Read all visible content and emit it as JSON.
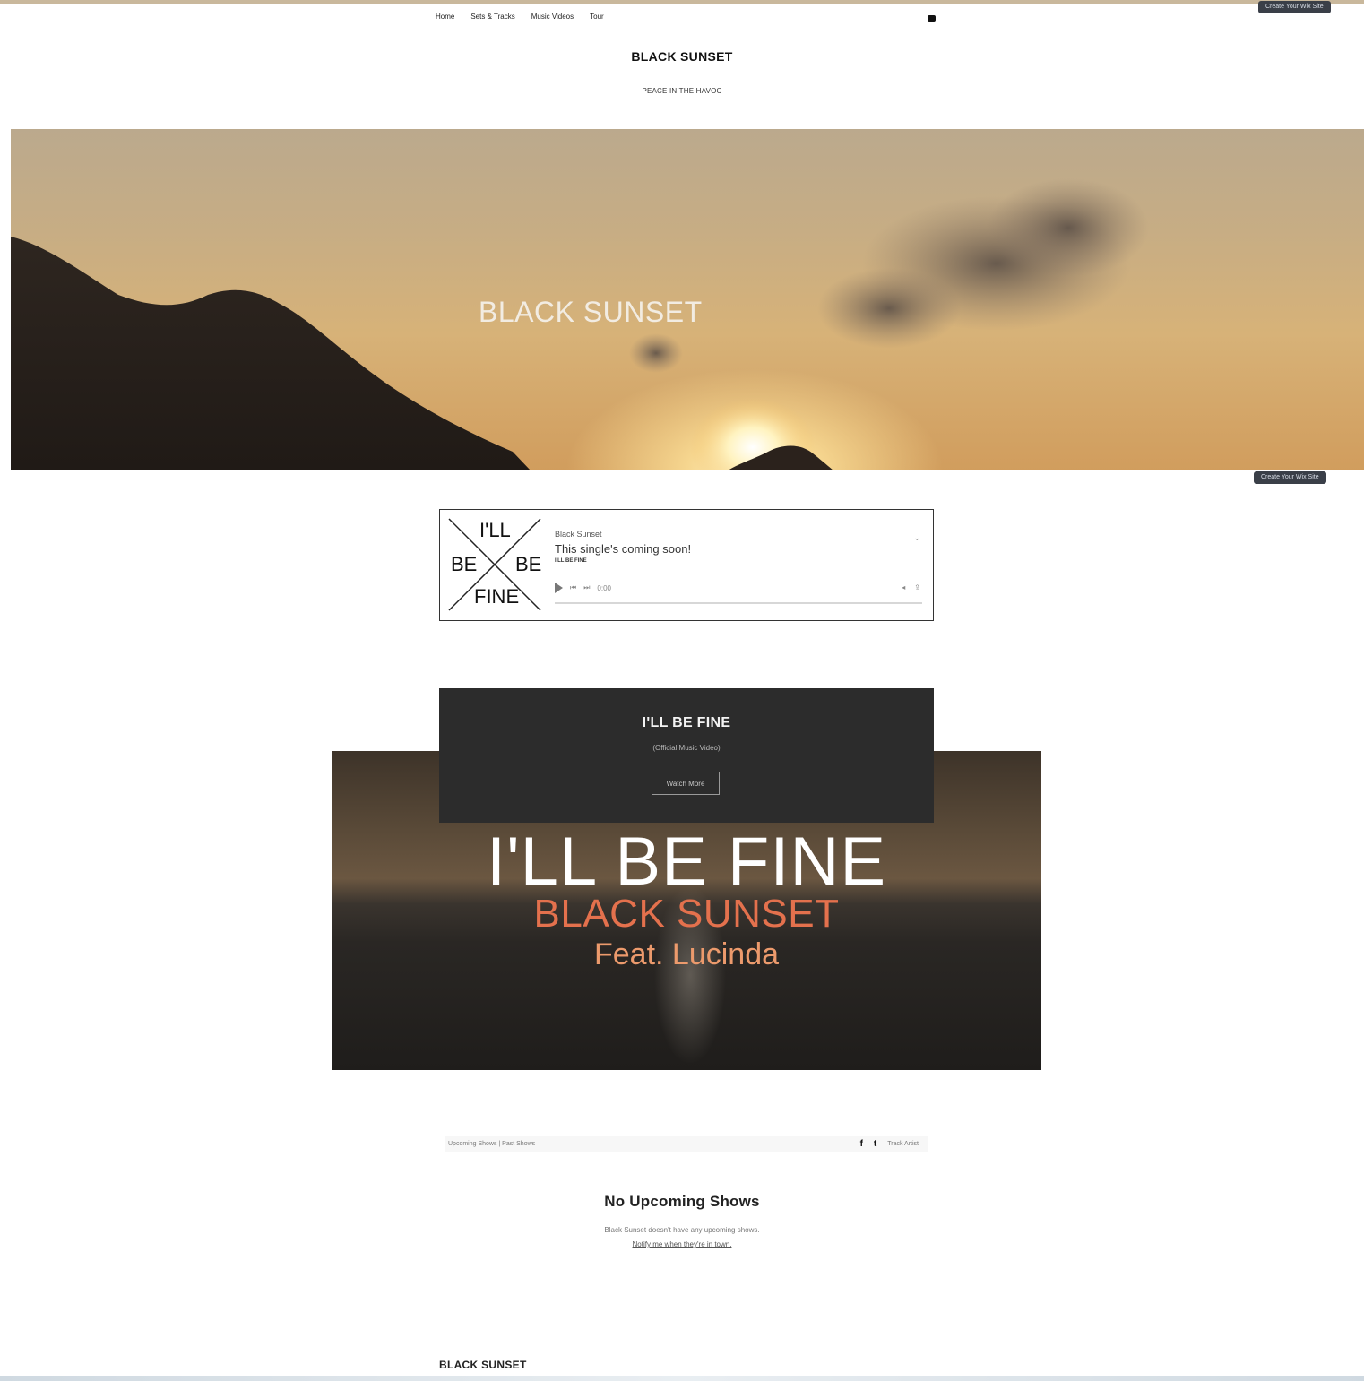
{
  "header": {
    "create_site_label": "Create Your Wix Site",
    "nav": [
      "Home",
      "Sets & Tracks",
      "Music Videos",
      "Tour"
    ],
    "site_title": "BLACK SUNSET",
    "tagline": "PEACE IN THE HAVOC"
  },
  "hero": {
    "title": "BLACK SUNSET",
    "create_site_label": "Create Your Wix Site"
  },
  "player": {
    "cover": {
      "line1": "I'LL",
      "left": "BE",
      "right": "BE",
      "line3": "FINE"
    },
    "artist": "Black Sunset",
    "status": "This single's coming soon!",
    "track": "I'LL BE FINE",
    "time": "0:00"
  },
  "video": {
    "box_title": "I'LL BE FINE",
    "box_subtitle": "(Official Music Video)",
    "button_label": "Watch More",
    "frame_title": "I'LL BE FINE",
    "frame_artist": "BLACK SUNSET",
    "frame_feat": "Feat. Lucinda"
  },
  "shows": {
    "tabs": "Upcoming Shows | Past Shows",
    "follow_label": "Track Artist",
    "empty_title": "No Upcoming Shows",
    "empty_text": "Black Sunset doesn't have any upcoming shows.",
    "empty_link": "Notify me when they're in town."
  },
  "footer": {
    "title": "BLACK SUNSET"
  }
}
